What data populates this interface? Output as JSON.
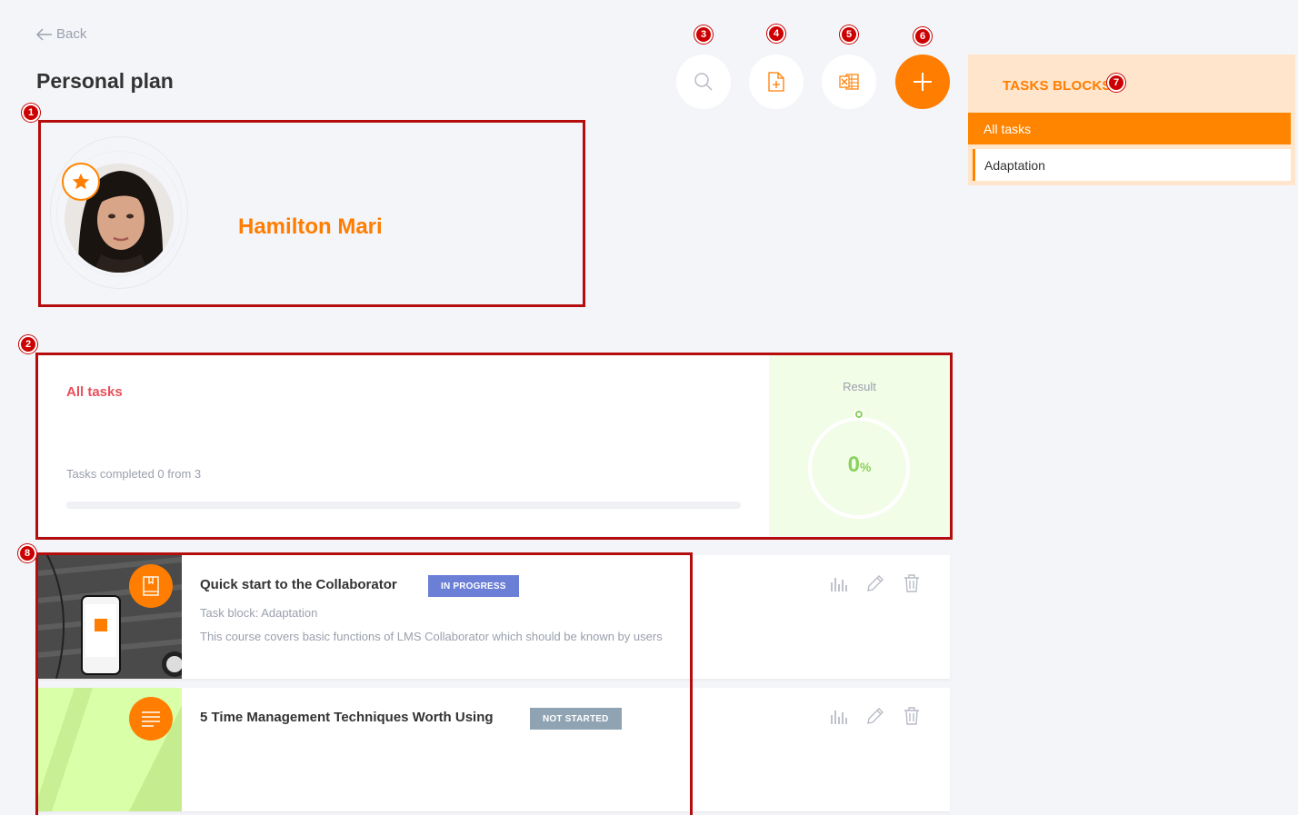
{
  "nav": {
    "back_label": "Back"
  },
  "page": {
    "title": "Personal plan"
  },
  "toolbar": {
    "search_icon": "search-icon",
    "add_file_icon": "add-file-icon",
    "excel_icon": "excel-icon",
    "add_icon": "plus-icon",
    "accent_color": "#ff7d00"
  },
  "callouts": [
    "1",
    "2",
    "3",
    "4",
    "5",
    "6",
    "7",
    "8"
  ],
  "sidebar": {
    "title": "TASKS BLOCKS",
    "items": [
      {
        "label": "All tasks",
        "active": true
      },
      {
        "label": "Adaptation",
        "active": false
      }
    ]
  },
  "user": {
    "name": "Hamilton Mari",
    "badge_icon": "star-icon"
  },
  "progress": {
    "title": "All tasks",
    "subtitle": "Tasks completed 0 from 3",
    "completed": 0,
    "total": 3,
    "result_label": "Result",
    "result_value": "0",
    "result_unit": "%"
  },
  "tasks": [
    {
      "title": "Quick start to the Collaborator",
      "status": "IN PROGRESS",
      "block": "Task block: Adaptation",
      "description": "This course covers basic functions of LMS Collaborator which should be known by users",
      "icon": "book-icon"
    },
    {
      "title": "5 Time Management Techniques Worth Using",
      "status": "NOT STARTED",
      "block": "",
      "description": "",
      "icon": "document-lines-icon"
    }
  ]
}
